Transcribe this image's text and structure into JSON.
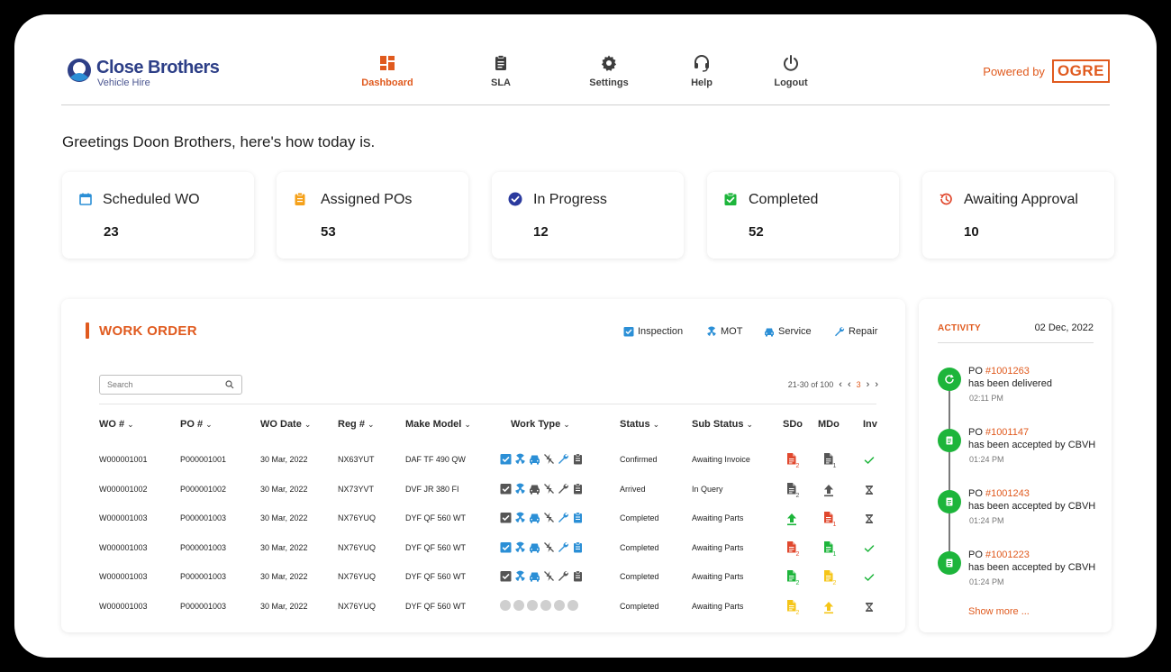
{
  "brand": {
    "name": "Close Brothers",
    "subtitle": "Vehicle Hire"
  },
  "nav": [
    {
      "label": "Dashboard",
      "icon": "dashboard-icon",
      "active": true
    },
    {
      "label": "SLA",
      "icon": "clipboard-icon"
    },
    {
      "label": "Settings",
      "icon": "gear-icon"
    },
    {
      "label": "Help",
      "icon": "headset-icon"
    },
    {
      "label": "Logout",
      "icon": "power-icon"
    }
  ],
  "powered": {
    "text": "Powered by",
    "logo": "OGRE"
  },
  "greeting": "Greetings Doon Brothers, here's how today is.",
  "stats": [
    {
      "label": "Scheduled WO",
      "value": "23",
      "icon": "calendar-icon",
      "color": "#2b8fd6"
    },
    {
      "label": "Assigned POs",
      "value": "53",
      "icon": "clipboard-icon",
      "color": "#f5a11a"
    },
    {
      "label": "In Progress",
      "value": "12",
      "icon": "check-circle-icon",
      "color": "#2b3a9e"
    },
    {
      "label": "Completed",
      "value": "52",
      "icon": "clipboard-check-icon",
      "color": "#1db53b"
    },
    {
      "label": "Awaiting Approval",
      "value": "10",
      "icon": "history-icon",
      "color": "#e0482e"
    }
  ],
  "work_order": {
    "title": "WORK ORDER",
    "legend": [
      {
        "label": "Inspection",
        "icon": "inspection-icon"
      },
      {
        "label": "MOT",
        "icon": "mot-icon"
      },
      {
        "label": "Service",
        "icon": "service-icon"
      },
      {
        "label": "Repair",
        "icon": "repair-icon"
      }
    ],
    "search_placeholder": "Search",
    "pager": {
      "range": "21-30 of 100",
      "current": "3"
    },
    "columns": [
      "WO #",
      "PO #",
      "WO Date",
      "Reg #",
      "Make Model",
      "Work Type",
      "Status",
      "Sub Status",
      "SDo",
      "MDo",
      "Inv"
    ],
    "rows": [
      {
        "wo": "W000001001",
        "po": "P000001001",
        "date": "30 Mar, 2022",
        "reg": "NX63YUT",
        "model": "DAF TF 490 QW",
        "status": "Confirmed",
        "sub": "Awaiting Invoice",
        "wt": [
          "b",
          "b",
          "b",
          "g",
          "b",
          "g"
        ],
        "sdo": [
          "doc",
          "red",
          "2"
        ],
        "mdo": [
          "doc",
          "gray",
          "1"
        ],
        "inv": "check"
      },
      {
        "wo": "W000001002",
        "po": "P000001002",
        "date": "30 Mar, 2022",
        "reg": "NX73YVT",
        "model": "DVF JR 380 FI",
        "status": "Arrived",
        "sub": "In Query",
        "wt": [
          "g",
          "b",
          "g",
          "g",
          "g",
          "g"
        ],
        "sdo": [
          "doc",
          "gray",
          "2"
        ],
        "mdo": [
          "up",
          "gray",
          ""
        ],
        "inv": "hourglass"
      },
      {
        "wo": "W000001003",
        "po": "P000001003",
        "date": "30 Mar, 2022",
        "reg": "NX76YUQ",
        "model": "DYF QF 560 WT",
        "status": "Completed",
        "sub": "Awaiting Parts",
        "wt": [
          "g",
          "b",
          "b",
          "g",
          "b",
          "b"
        ],
        "sdo": [
          "up",
          "green",
          ""
        ],
        "mdo": [
          "doc",
          "red",
          "1"
        ],
        "inv": "hourglass"
      },
      {
        "wo": "W000001003",
        "po": "P000001003",
        "date": "30 Mar, 2022",
        "reg": "NX76YUQ",
        "model": "DYF QF 560 WT",
        "status": "Completed",
        "sub": "Awaiting Parts",
        "wt": [
          "b",
          "b",
          "b",
          "g",
          "b",
          "b"
        ],
        "sdo": [
          "doc",
          "red",
          "2"
        ],
        "mdo": [
          "doc",
          "green",
          "1"
        ],
        "inv": "check"
      },
      {
        "wo": "W000001003",
        "po": "P000001003",
        "date": "30 Mar, 2022",
        "reg": "NX76YUQ",
        "model": "DYF QF 560 WT",
        "status": "Completed",
        "sub": "Awaiting Parts",
        "wt": [
          "g",
          "b",
          "b",
          "g",
          "g",
          "g"
        ],
        "sdo": [
          "doc",
          "green",
          "2"
        ],
        "mdo": [
          "doc",
          "yellow",
          "2"
        ],
        "inv": "check"
      },
      {
        "wo": "W000001003",
        "po": "P000001003",
        "date": "30 Mar, 2022",
        "reg": "NX76YUQ",
        "model": "DYF QF 560 WT",
        "status": "Completed",
        "sub": "Awaiting Parts",
        "wt": [
          "dot",
          "dot",
          "dot",
          "dot",
          "dot",
          "dot"
        ],
        "sdo": [
          "doc",
          "yellow",
          "2"
        ],
        "mdo": [
          "up",
          "yellow",
          ""
        ],
        "inv": "hourglass"
      }
    ]
  },
  "activity": {
    "title": "ACTIVITY",
    "date": "02 Dec, 2022",
    "items": [
      {
        "prefix": "PO ",
        "po": "#1001263",
        "text": "has been delivered",
        "time": "02:11 PM",
        "icon": "refresh-icon"
      },
      {
        "prefix": "PO ",
        "po": "#1001147",
        "text": "has been accepted by CBVH",
        "time": "01:24 PM",
        "icon": "document-icon"
      },
      {
        "prefix": "PO ",
        "po": "#1001243",
        "text": "has been accepted by CBVH",
        "time": "01:24 PM",
        "icon": "document-icon"
      },
      {
        "prefix": "PO ",
        "po": "#1001223",
        "text": "has been accepted by CBVH",
        "time": "01:24 PM",
        "icon": "document-icon"
      }
    ],
    "show_more": "Show more ..."
  },
  "colors": {
    "accent": "#e05a1e",
    "brand": "#2d3f87",
    "green": "#1db53b",
    "blue": "#2b8fd6",
    "red": "#e0482e",
    "yellow": "#f5c518",
    "gray": "#555555"
  }
}
